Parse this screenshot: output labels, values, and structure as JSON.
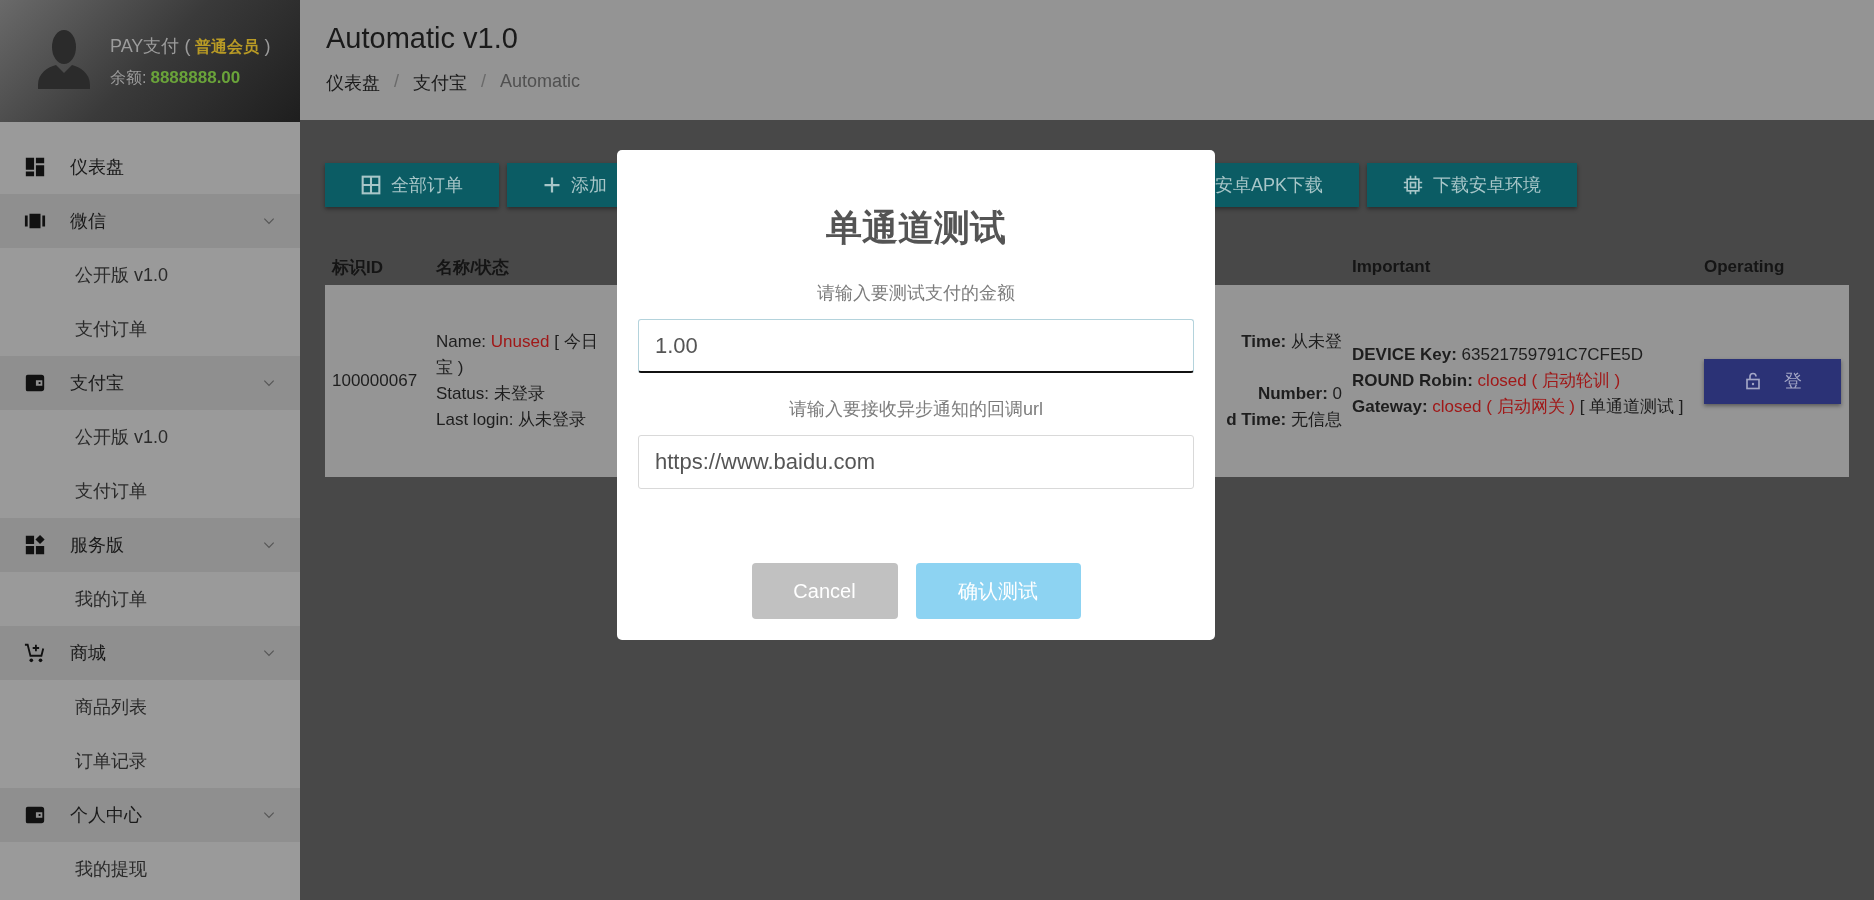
{
  "profile": {
    "name": "PAY支付",
    "open": "(",
    "level": "普通会员",
    "close": ")",
    "balance_label": "余额:",
    "balance": "8888888.00"
  },
  "header": {
    "title": "Automatic v1.0",
    "breadcrumb": [
      {
        "label": "仪表盘"
      },
      {
        "separator": "/",
        "label": "支付宝"
      },
      {
        "separator": "/",
        "label": "Automatic"
      }
    ]
  },
  "sidebar": {
    "items": [
      {
        "label": "仪表盘",
        "kind": "link"
      },
      {
        "label": "微信",
        "kind": "group",
        "expanded": true,
        "children": [
          "公开版 v1.0",
          "支付订单"
        ]
      },
      {
        "label": "支付宝",
        "kind": "group",
        "expanded": true,
        "children": [
          "公开版 v1.0",
          "支付订单"
        ]
      },
      {
        "label": "服务版",
        "kind": "group",
        "expanded": true,
        "children": [
          "我的订单"
        ]
      },
      {
        "label": "商城",
        "kind": "group",
        "expanded": true,
        "children": [
          "商品列表",
          "订单记录"
        ]
      },
      {
        "label": "个人中心",
        "kind": "group",
        "expanded": true,
        "children": [
          "我的提现"
        ]
      }
    ]
  },
  "toolbar": [
    "全部订单",
    "添加",
    "安卓APK下载",
    "下载安卓环境"
  ],
  "table": {
    "columns": [
      "标识ID",
      "名称/状态",
      "Important",
      "Operating"
    ],
    "rows": [
      {
        "id": "100000067",
        "name_status": [
          "Name: **Unused** [ 今日",
          "宝 )",
          "Status: 未登录",
          "Last login: 从未登录"
        ],
        "column_3": [
          "**Time:** 从未登",
          "**Number:** 0",
          "**d Time:** 无信息"
        ],
        "important": [
          {
            "label": "DEVICE Key:",
            "value": "63521759791C7CFE5D",
            "alert": false
          },
          {
            "label": "ROUND Robin:",
            "value": "closed ( 启动轮训 )",
            "alert": true
          },
          {
            "label": "Gateway:",
            "value": "closed ( 启动网关 )",
            "alert": true,
            "note": "[ 单通道测试 ]"
          }
        ],
        "action": "登"
      }
    ]
  },
  "modal": {
    "title": "单通道测试",
    "fields": [
      {
        "label": "请输入要测试支付的金额",
        "value": "1.00",
        "focused": true
      },
      {
        "label": "请输入要接收异步通知的回调url",
        "value": "https://www.baidu.com",
        "focused": false
      }
    ],
    "buttons": [
      {
        "label": "Cancel",
        "kind": "cancel"
      },
      {
        "label": "确认测试",
        "kind": "confirm"
      }
    ]
  }
}
